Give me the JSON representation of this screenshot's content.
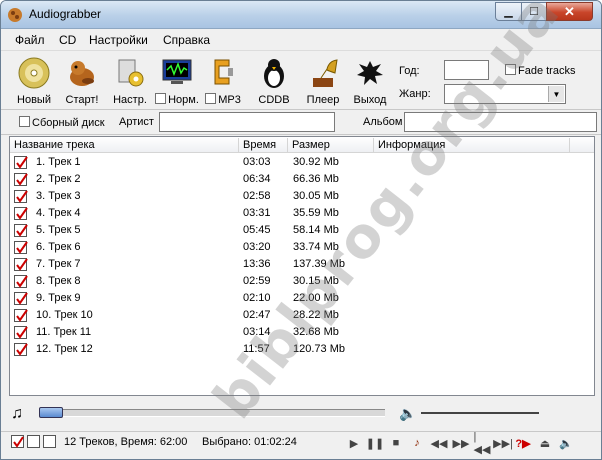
{
  "window": {
    "title": "Audiograbber"
  },
  "menu": [
    "Файл",
    "CD",
    "Настройки",
    "Справка"
  ],
  "toolbar": {
    "new": "Новый",
    "start": "Старт!",
    "settings": "Настр.",
    "normalize": "Норм.",
    "mp3": "MP3",
    "cddb": "CDDB",
    "player": "Плеер",
    "exit": "Выход"
  },
  "fields": {
    "year_label": "Год:",
    "genre_label": "Жанр:",
    "fade_label": "Fade tracks"
  },
  "options": {
    "compilation_label": "Сборный диск",
    "artist_label": "Артист",
    "album_label": "Альбом"
  },
  "table": {
    "headers": [
      "Название трека",
      "Время",
      "Размер",
      "Информация"
    ],
    "rows": [
      {
        "name": "1. Трек  1",
        "time": "03:03",
        "size": "30.92 Mb"
      },
      {
        "name": "2. Трек  2",
        "time": "06:34",
        "size": "66.36 Mb"
      },
      {
        "name": "3. Трек  3",
        "time": "02:58",
        "size": "30.05 Mb"
      },
      {
        "name": "4. Трек  4",
        "time": "03:31",
        "size": "35.59 Mb"
      },
      {
        "name": "5. Трек  5",
        "time": "05:45",
        "size": "58.14 Mb"
      },
      {
        "name": "6. Трек  6",
        "time": "03:20",
        "size": "33.74 Mb"
      },
      {
        "name": "7. Трек  7",
        "time": "13:36",
        "size": "137.39 Mb"
      },
      {
        "name": "8. Трек  8",
        "time": "02:59",
        "size": "30.15 Mb"
      },
      {
        "name": "9. Трек  9",
        "time": "02:10",
        "size": "22.00 Mb"
      },
      {
        "name": "10. Трек 10",
        "time": "02:47",
        "size": "28.22 Mb"
      },
      {
        "name": "11. Трек 11",
        "time": "03:14",
        "size": "32.68 Mb"
      },
      {
        "name": "12. Трек 12",
        "time": "11:57",
        "size": "120.73 Mb"
      }
    ]
  },
  "status": {
    "tracks": "12 Треков,  Время: 62:00",
    "selected": "Выбрано: 01:02:24"
  },
  "watermark": "biblprog.org.ua"
}
